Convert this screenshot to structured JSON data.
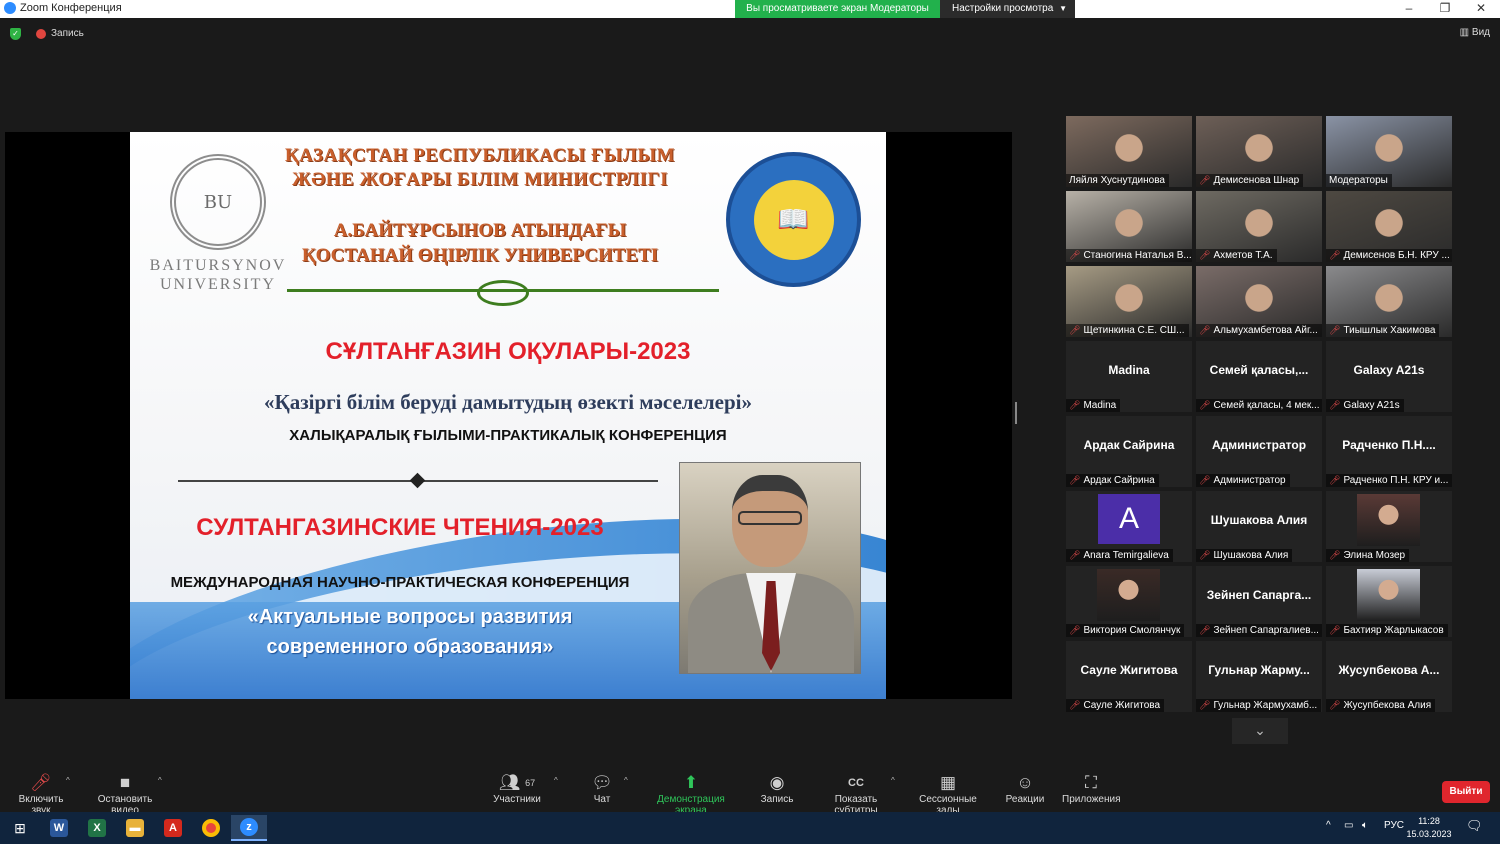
{
  "window": {
    "title": "Zoom Конференция",
    "share_banner": "Вы просматриваете экран Модераторы",
    "view_settings": "Настройки просмотра"
  },
  "topbar": {
    "recording": "Запись",
    "view": "Вид"
  },
  "slide": {
    "university": [
      "BAITURSYNOV",
      "UNIVERSITY"
    ],
    "ministry_line1": "ҚАЗАҚСТАН РЕСПУБЛИКАСЫ ҒЫЛЫМ",
    "ministry_line2": "ЖӘНЕ ЖОҒАРЫ БІЛІМ МИНИСТРЛІГІ",
    "uni_line1": "А.БАЙТҰРСЫНОВ АТЫНДАҒЫ",
    "uni_line2": "ҚОСТАНАЙ ӨҢІРЛІК УНИВЕРСИТЕТІ",
    "kz_title": "СҰЛТАНҒАЗИН ОҚУЛАРЫ-2023",
    "kz_subtitle": "«Қазіргі білім беруді дамытудың өзекті мәселелері»",
    "kz_conference": "ХАЛЫҚАРАЛЫҚ ҒЫЛЫМИ-ПРАКТИКАЛЫҚ КОНФЕРЕНЦИЯ",
    "ru_title": "СУЛТАНГАЗИНСКИЕ ЧТЕНИЯ-2023",
    "ru_conference": "МЕЖДУНАРОДНАЯ НАУЧНО-ПРАКТИЧЕСКАЯ КОНФЕРЕНЦИЯ",
    "ru_subtitle1": "«Актуальные вопросы развития",
    "ru_subtitle2": "современного образования»"
  },
  "participants": [
    {
      "label": "Ляйля Хуснутдинова",
      "big": "",
      "kind": "video",
      "bg": "#7d6a5e",
      "active": true,
      "muted": false
    },
    {
      "label": "Демисенова Шнар",
      "big": "",
      "kind": "video",
      "bg": "#6d5f57",
      "active": false,
      "muted": true
    },
    {
      "label": "Модераторы",
      "big": "",
      "kind": "video",
      "bg": "#8a93a5",
      "active": false,
      "muted": false
    },
    {
      "label": "Станогина Наталья В...",
      "big": "",
      "kind": "video",
      "bg": "#b7b1a7",
      "active": false,
      "muted": true
    },
    {
      "label": "Ахметов Т.А.",
      "big": "",
      "kind": "video",
      "bg": "#6e6a62",
      "active": false,
      "muted": true
    },
    {
      "label": "Демисенов Б.Н. КРУ ...",
      "big": "",
      "kind": "video",
      "bg": "#4e4942",
      "active": false,
      "muted": true
    },
    {
      "label": "Щетинкина С.Е. СШ...",
      "big": "",
      "kind": "video",
      "bg": "#a69b84",
      "active": false,
      "muted": true
    },
    {
      "label": "Альмухамбетова Айг...",
      "big": "",
      "kind": "video",
      "bg": "#7a6c68",
      "active": false,
      "muted": true
    },
    {
      "label": "Тиышлык Хакимова",
      "big": "",
      "kind": "video",
      "bg": "#8a8a8c",
      "active": false,
      "muted": true
    },
    {
      "label": "Madina",
      "big": "Madina",
      "kind": "name",
      "active": false,
      "muted": true
    },
    {
      "label": "Семей қаласы, 4 мек...",
      "big": "Семей қаласы,...",
      "kind": "name",
      "active": false,
      "muted": true
    },
    {
      "label": "Galaxy A21s",
      "big": "Galaxy A21s",
      "kind": "name",
      "active": false,
      "muted": true
    },
    {
      "label": "Ардак Сайрина",
      "big": "Ардак Сайрина",
      "kind": "name",
      "active": false,
      "muted": true
    },
    {
      "label": "Администратор",
      "big": "Администратор",
      "kind": "name",
      "active": false,
      "muted": true
    },
    {
      "label": "Радченко П.Н. КРУ и...",
      "big": "Радченко П.Н....",
      "kind": "name",
      "active": false,
      "muted": true
    },
    {
      "label": "Anara Temirgalieva",
      "big": "A",
      "kind": "avatar",
      "bg": "#4b2ea8",
      "active": false,
      "muted": true
    },
    {
      "label": "Шушакова Алия",
      "big": "Шушакова Алия",
      "kind": "name",
      "active": false,
      "muted": true
    },
    {
      "label": "Элина Мозер",
      "big": "",
      "kind": "thumb",
      "bg": "#5a3a36",
      "active": false,
      "muted": true
    },
    {
      "label": "Виктория Смолянчук",
      "big": "",
      "kind": "thumb",
      "bg": "#3a2a26",
      "active": false,
      "muted": true
    },
    {
      "label": "Зейнеп Сапаргалиев...",
      "big": "Зейнеп Сапарга...",
      "kind": "name",
      "active": false,
      "muted": true
    },
    {
      "label": "Бахтияр Жарлыкасов",
      "big": "",
      "kind": "thumb",
      "bg": "#c8ccd6",
      "active": false,
      "muted": true
    },
    {
      "label": "Сауле Жигитова",
      "big": "Сауле Жигитова",
      "kind": "name",
      "active": false,
      "muted": true
    },
    {
      "label": "Гульнар Жармухамб...",
      "big": "Гульнар Жарму...",
      "kind": "name",
      "active": false,
      "muted": true
    },
    {
      "label": "Жусупбекова Алия",
      "big": "Жусупбекова А...",
      "kind": "name",
      "active": false,
      "muted": true
    }
  ],
  "toolbar": {
    "unmute": "Включить звук",
    "stop_video": "Остановить видео",
    "participants": "Участники",
    "participants_count": "67",
    "chat": "Чат",
    "share_screen": "Демонстрация экрана",
    "record": "Запись",
    "captions": "Показать субтитры",
    "breakout": "Сессионные залы",
    "reactions": "Реакции",
    "apps": "Приложения",
    "leave": "Выйти"
  },
  "taskbar": {
    "lang": "РУС",
    "time": "11:28",
    "date": "15.03.2023"
  },
  "colors": {
    "share_green": "#22b14c",
    "leave_red": "#e0262d",
    "active_speaker": "#d4e157",
    "slide_red": "#e3202a"
  }
}
